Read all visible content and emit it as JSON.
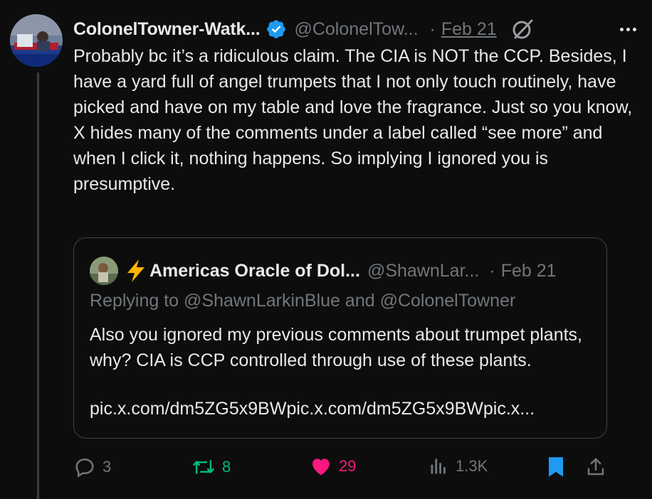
{
  "tweet": {
    "author_name": "ColonelTowner-Watk...",
    "author_handle": "@ColonelTow...",
    "separator": "·",
    "date": "Feb 21",
    "body": "Probably bc it’s a ridiculous claim. The CIA is NOT the CCP. Besides, I have a yard full of angel trumpets that I not only touch routinely, have picked and have on my table and love the fragrance. Just so you know, X hides many of the comments under a label called “see more” and when I click it, nothing happens. So implying I ignored you is presumptive."
  },
  "quote": {
    "author_name": "Americas Oracle of Dol...",
    "author_handle": "@ShawnLar...",
    "separator": "·",
    "date": "Feb 21",
    "replying_to": "Replying to @ShawnLarkinBlue and @ColonelTowner",
    "body": "Also you ignored my previous comments about trumpet plants, why? CIA is CCP controlled through use of these plants.",
    "link": "pic.x.com/dm5ZG5x9BWpic.x.com/dm5ZG5x9BWpic.x..."
  },
  "actions": {
    "replies": "3",
    "reposts": "8",
    "likes": "29",
    "views": "1.3K"
  },
  "colors": {
    "background": "#0d0d0d",
    "text": "#e7e9ea",
    "muted": "#71767b",
    "verified": "#1d9bf0",
    "repost": "#00ba7c",
    "like": "#f91880",
    "bookmark": "#1d9bf0"
  },
  "icons": [
    "verified-badge-icon",
    "grok-icon",
    "more-icon",
    "lightning-bolt-icon",
    "reply-icon",
    "repost-icon",
    "like-icon",
    "views-icon",
    "bookmark-icon",
    "share-icon"
  ]
}
